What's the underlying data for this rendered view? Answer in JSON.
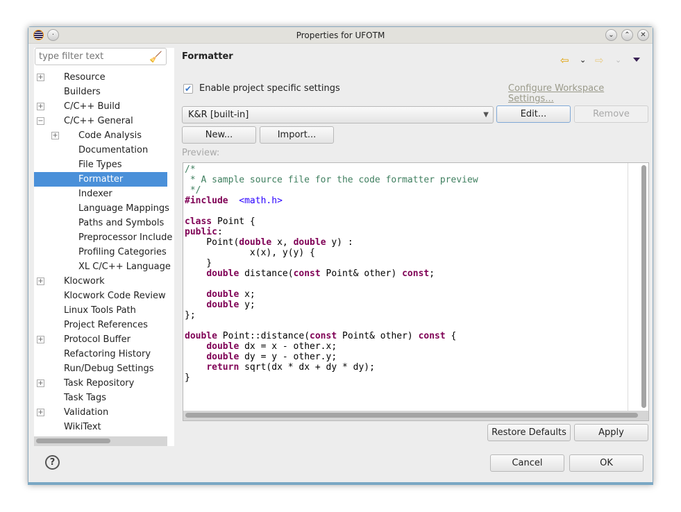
{
  "window": {
    "title": "Properties for UFOTM"
  },
  "filter": {
    "placeholder": "type filter text"
  },
  "tree": [
    {
      "label": "Resource",
      "level": 1,
      "expandable": true
    },
    {
      "label": "Builders",
      "level": 1,
      "expandable": false
    },
    {
      "label": "C/C++ Build",
      "level": 1,
      "expandable": true
    },
    {
      "label": "C/C++ General",
      "level": 1,
      "expandable": true,
      "expanded": true
    },
    {
      "label": "Code Analysis",
      "level": 2,
      "expandable": true
    },
    {
      "label": "Documentation",
      "level": 2,
      "expandable": false
    },
    {
      "label": "File Types",
      "level": 2,
      "expandable": false
    },
    {
      "label": "Formatter",
      "level": 2,
      "expandable": false,
      "selected": true
    },
    {
      "label": "Indexer",
      "level": 2,
      "expandable": false
    },
    {
      "label": "Language Mappings",
      "level": 2,
      "expandable": false
    },
    {
      "label": "Paths and Symbols",
      "level": 2,
      "expandable": false
    },
    {
      "label": "Preprocessor Include",
      "level": 2,
      "expandable": false
    },
    {
      "label": "Profiling Categories",
      "level": 2,
      "expandable": false
    },
    {
      "label": "XL C/C++ Language",
      "level": 2,
      "expandable": false
    },
    {
      "label": "Klocwork",
      "level": 1,
      "expandable": true
    },
    {
      "label": "Klocwork Code Review",
      "level": 1,
      "expandable": false
    },
    {
      "label": "Linux Tools Path",
      "level": 1,
      "expandable": false
    },
    {
      "label": "Project References",
      "level": 1,
      "expandable": false
    },
    {
      "label": "Protocol Buffer",
      "level": 1,
      "expandable": true
    },
    {
      "label": "Refactoring History",
      "level": 1,
      "expandable": false
    },
    {
      "label": "Run/Debug Settings",
      "level": 1,
      "expandable": false
    },
    {
      "label": "Task Repository",
      "level": 1,
      "expandable": true
    },
    {
      "label": "Task Tags",
      "level": 1,
      "expandable": false
    },
    {
      "label": "Validation",
      "level": 1,
      "expandable": true
    },
    {
      "label": "WikiText",
      "level": 1,
      "expandable": false
    }
  ],
  "page": {
    "title": "Formatter",
    "enable_label": "Enable project specific settings",
    "enable_checked": true,
    "configure_link": "Configure Workspace Settings...",
    "profile_value": "K&R [built-in]",
    "edit": "Edit...",
    "remove": "Remove",
    "new": "New...",
    "import": "Import...",
    "preview_label": "Preview:",
    "restore": "Restore Defaults",
    "apply": "Apply"
  },
  "footer": {
    "cancel": "Cancel",
    "ok": "OK"
  },
  "code": [
    [
      [
        "cm",
        "/*"
      ]
    ],
    [
      [
        "cm",
        " * A sample source file for the code formatter preview"
      ]
    ],
    [
      [
        "cm",
        " */"
      ]
    ],
    [
      [
        "kw",
        "#include"
      ],
      [
        "",
        "  "
      ],
      [
        "st",
        "<math.h>"
      ]
    ],
    [],
    [
      [
        "kw",
        "class"
      ],
      [
        "",
        " Point {"
      ]
    ],
    [
      [
        "kw",
        "public"
      ],
      [
        "",
        ":"
      ]
    ],
    [
      [
        "",
        "    Point("
      ],
      [
        "kw",
        "double"
      ],
      [
        "",
        " x, "
      ],
      [
        "kw",
        "double"
      ],
      [
        "",
        " y) :"
      ]
    ],
    [
      [
        "",
        "            x(x), y(y) {"
      ]
    ],
    [
      [
        "",
        "    }"
      ]
    ],
    [
      [
        "",
        "    "
      ],
      [
        "kw",
        "double"
      ],
      [
        "",
        " distance("
      ],
      [
        "kw",
        "const"
      ],
      [
        "",
        " Point& other) "
      ],
      [
        "kw",
        "const"
      ],
      [
        "",
        ";"
      ]
    ],
    [],
    [
      [
        "",
        "    "
      ],
      [
        "kw",
        "double"
      ],
      [
        "",
        " x;"
      ]
    ],
    [
      [
        "",
        "    "
      ],
      [
        "kw",
        "double"
      ],
      [
        "",
        " y;"
      ]
    ],
    [
      [
        "",
        "};"
      ]
    ],
    [],
    [
      [
        "kw",
        "double"
      ],
      [
        "",
        " Point::distance("
      ],
      [
        "kw",
        "const"
      ],
      [
        "",
        " Point& other) "
      ],
      [
        "kw",
        "const"
      ],
      [
        "",
        " {"
      ]
    ],
    [
      [
        "",
        "    "
      ],
      [
        "kw",
        "double"
      ],
      [
        "",
        " dx = x - other.x;"
      ]
    ],
    [
      [
        "",
        "    "
      ],
      [
        "kw",
        "double"
      ],
      [
        "",
        " dy = y - other.y;"
      ]
    ],
    [
      [
        "",
        "    "
      ],
      [
        "kw",
        "return"
      ],
      [
        "",
        " sqrt(dx * dx + dy * dy);"
      ]
    ],
    [
      [
        "",
        "}"
      ]
    ]
  ],
  "colors": {
    "selection": "#4a90d9",
    "keyword": "#7f0055",
    "comment": "#3f7f5f",
    "string": "#2a00ff",
    "link": "#9a9a8a"
  },
  "icons": {
    "app": "eclipse-icon",
    "filter_clear": "broom-icon",
    "back": "back-arrow-icon",
    "forward": "forward-arrow-icon",
    "help": "help-icon"
  }
}
